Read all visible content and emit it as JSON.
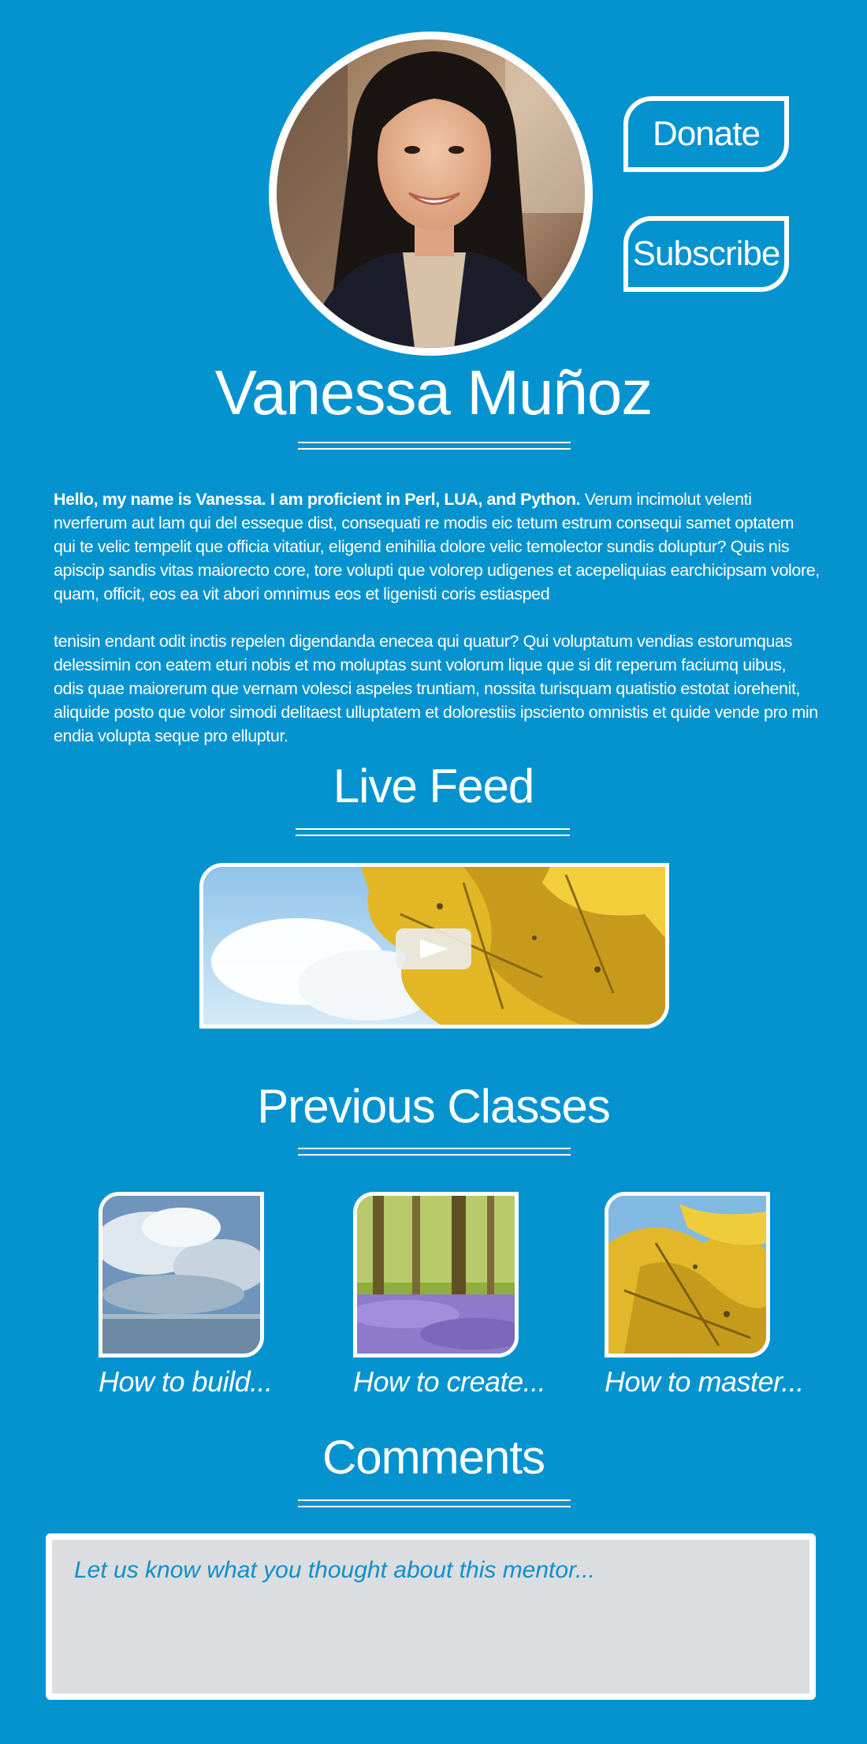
{
  "profile": {
    "name": "Vanessa Muñoz",
    "photo_alt": "mentor-portrait"
  },
  "actions": {
    "donate_label": "Donate",
    "subscribe_label": "Subscribe"
  },
  "bio": {
    "intro_bold": "Hello, my name is Vanessa. I am proficient in Perl, LUA, and Python.",
    "intro_rest": " Verum incimolut velenti nverferum aut lam qui del esseque dist, consequati re modis eic tetum estrum consequi samet optatem qui te velic tempelit que officia vitatiur, eligend enihilia dolore velic temolector sundis doluptur? Quis nis apiscip sandis vitas maiorecto core, tore volupti que volorep udigenes et acepeliquias earchicipsam volore, quam, officit, eos ea vit abori omnimus eos et ligenisti coris estiasped",
    "paragraph2": "tenisin endant odit inctis repelen digendanda enecea qui quatur? Qui voluptatum vendias estorumquas delessimin con eatem eturi nobis et mo moluptas sunt volorum lique que si dit reperum faciumq uibus, odis quae maiorerum que vernam volesci aspeles truntiam, nossita turisquam quatistio estotat iorehenit, aliquide posto que volor simodi delitaest ulluptatem et dolorestiis ipsciento omnistis et quide vende pro min endia volupta seque pro elluptur."
  },
  "live_feed": {
    "title": "Live Feed"
  },
  "previous_classes": {
    "title": "Previous Classes",
    "items": [
      {
        "label": "How to build..."
      },
      {
        "label": "How to create..."
      },
      {
        "label": "How to master..."
      }
    ]
  },
  "comments": {
    "title": "Comments",
    "placeholder": "Let us know what you thought about this mentor..."
  },
  "colors": {
    "background": "#0593d0",
    "foreground": "#ffffff",
    "comment_box": "#dcdde0"
  }
}
